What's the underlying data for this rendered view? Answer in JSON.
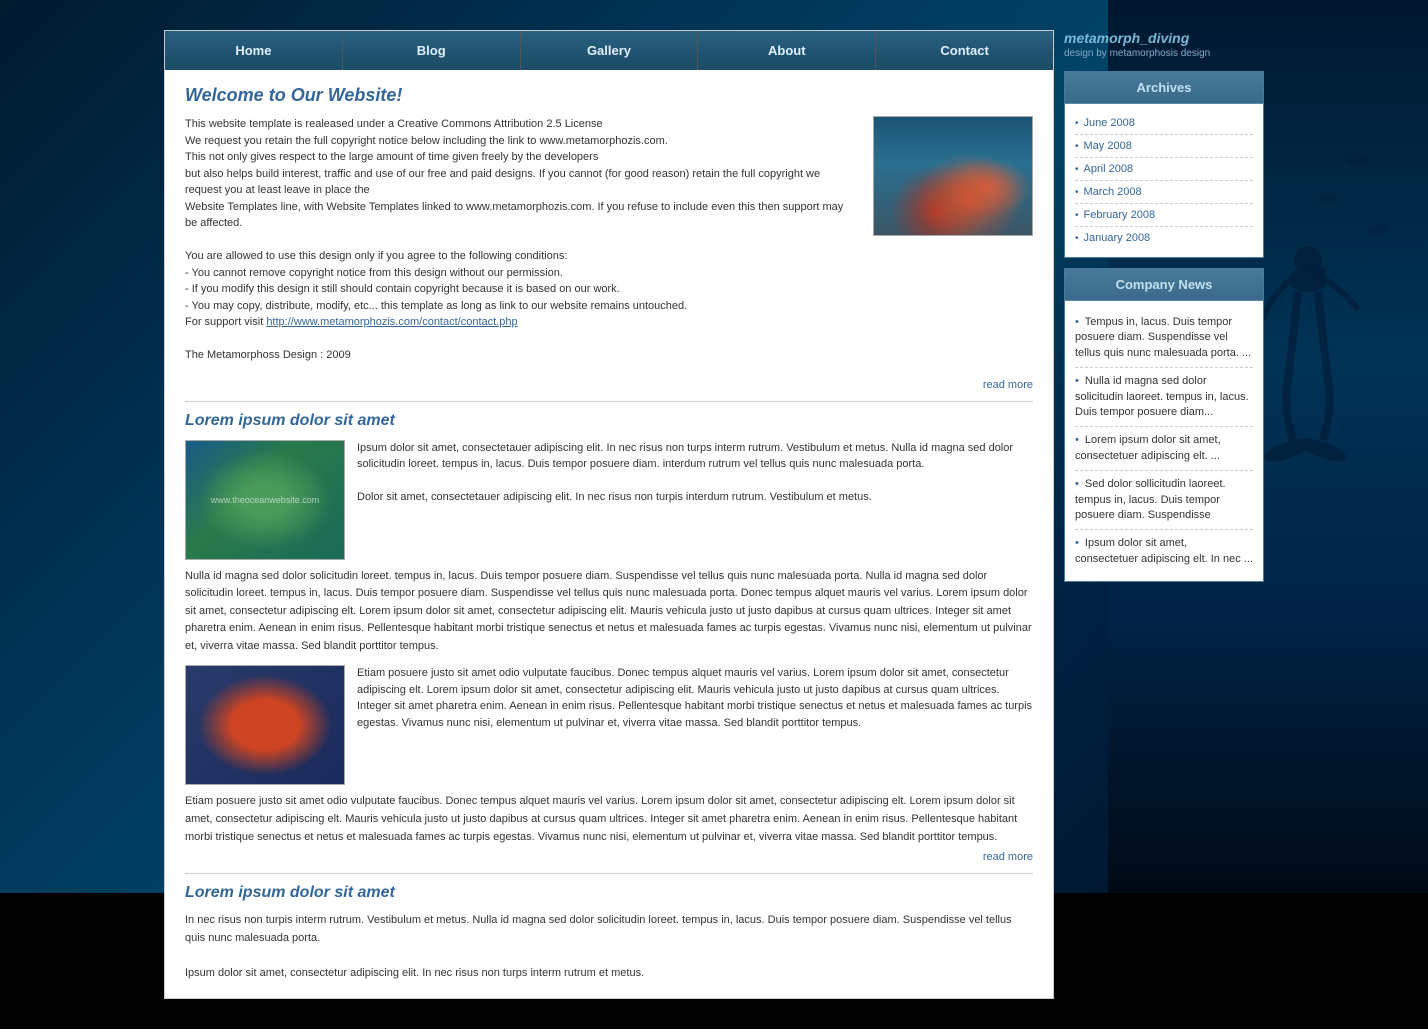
{
  "site": {
    "brand": "metamorph_diving",
    "tagline": "design by metamorphosis design"
  },
  "nav": {
    "items": [
      {
        "label": "Home",
        "id": "home"
      },
      {
        "label": "Blog",
        "id": "blog"
      },
      {
        "label": "Gallery",
        "id": "gallery"
      },
      {
        "label": "About",
        "id": "about"
      },
      {
        "label": "Contact",
        "id": "contact"
      }
    ]
  },
  "main": {
    "welcome_title": "Welcome to Our Website!",
    "welcome_text_1": "This website template is realeased under a Creative Commons Attribution 2.5 License",
    "welcome_text_2": "We request you retain the full copyright notice below including the link to www.metamorphozis.com.",
    "welcome_text_3": "This not only gives respect to the large amount of time given freely by the developers",
    "welcome_text_4": "but also helps build interest, traffic and use of our free and paid designs. If you cannot (for good reason) retain the full copyright we request you at least leave in place the",
    "welcome_text_5": "Website Templates line, with Website Templates linked to www.metamorphozis.com. If you refuse to include even this then support may be affected.",
    "welcome_text_6": "You are allowed to use this design only if you agree to the following conditions:",
    "welcome_text_7": "- You cannot remove copyright notice from this design without our permission.",
    "welcome_text_8": "- If you modify this design it still should contain copyright because it is based on our work.",
    "welcome_text_9": "- You may copy, distribute, modify, etc... this template as long as link to our website remains untouched.",
    "welcome_text_10": "For support visit ",
    "welcome_link": "http://www.metamorphozis.com/contact/contact.php",
    "welcome_copyright": "The Metamorphoss Design : 2009",
    "read_more": "read more",
    "article1_title": "Lorem ipsum dolor sit amet",
    "article1_text1": "Ipsum dolor sit amet, consectetauer adipiscing elit. In nec risus non turps interm rutrum. Vestibulum et metus. Nulla id magna sed dolor solicitudin loreet. tempus in, lacus. Duis tempor posuere diam. interdum rutrum vel tellus quis nunc malesuada porta.",
    "article1_text2": "Dolor sit amet, consectetauer adipiscing elit. In nec risus non turpis interdum rutrum. Vestibulum et metus.",
    "article1_text3": "Nulla id magna sed dolor solicitudin loreet. tempus in, lacus. Duis tempor posuere diam. Suspendisse vel tellus quis nunc malesuada porta. Nulla id magna sed dolor solicitudin loreet. tempus in, lacus. Duis tempor posuere diam. Suspendisse vel tellus quis nunc malesuada porta. Donec tempus alquet mauris vel varius. Lorem ipsum dolor sit amet, consectetur adipiscing elt. Lorem ipsum dolor sit amet, consectetur adipiscing elit. Mauris vehicula justo ut justo dapibus at cursus quam ultrices. Integer sit amet pharetra enim. Aenean in enim risus. Pellentesque habitant morbi tristique senectus et netus et malesuada fames ac turpis egestas. Vivamus nunc nisi, elementum ut pulvinar et, viverra vitae massa. Sed blandit porttitor tempus.",
    "article1_text4_intro": "Etiam posuere justo sit amet odio vulputate faucibus. Donec tempus alquet mauris vel varius. Lorem ipsum dolor sit amet, consectetur adipiscing elt. Lorem ipsum dolor sit amet, consectetur adipiscing elit. Mauris vehicula justo ut justo dapibus at cursus quam ultrices. Integer sit amet pharetra enim. Aenean in enim risus. Pellentesque habitant morbi tristique senectus et netus et malesuada fames ac turpis egestas. Vivamus nunc nisi, elementum ut pulvinar et, viverra vitae massa. Sed blandit porttitor tempus.",
    "article1_text4_body": "Etiam posuere justo sit amet odio vulputate faucibus. Donec tempus alquet mauris vel varius. Lorem ipsum dolor sit amet, consectetur adipiscing elt. Lorem ipsum dolor sit amet, consectetur adipiscing elt. Mauris vehicula justo ut justo dapibus at cursus quam ultrices. Integer sit amet pharetra enim. Aenean in enim risus. Pellentesque habitant morbi tristique senectus et netus et malesuada fames ac turpis egestas. Vivamus nunc nisi, elementum ut pulvinar et, viverra vitae massa. Sed blandit porttitor tempus.",
    "article2_title": "Lorem ipsum dolor sit amet",
    "article2_text1": "In nec risus non turpis interm rutrum. Vestibulum et metus. Nulla id magna sed dolor solicitudin loreet. tempus in, lacus. Duis tempor posuere diam. Suspendisse vel tellus quis nunc malesuada porta.",
    "article2_text2": "Ipsum dolor sit amet, consectetur adipiscing elit. In nec risus non turps interm rutrum et metus.",
    "watermark": "www.theoceanwebsite.com"
  },
  "sidebar": {
    "archives_title": "Archives",
    "archives": [
      {
        "label": "June 2008"
      },
      {
        "label": "May 2008"
      },
      {
        "label": "April 2008"
      },
      {
        "label": "March 2008"
      },
      {
        "label": "February 2008"
      },
      {
        "label": "January 2008"
      }
    ],
    "news_title": "Company News",
    "news_items": [
      {
        "text": "Tempus in, lacus. Duis tempor posuere diam. Suspendisse vel tellus quis nunc malesuada porta. ..."
      },
      {
        "text": "Nulla id magna sed dolor solicitudin laoreet. tempus in, lacus. Duis tempor posuere diam..."
      },
      {
        "text": "Lorem ipsum dolor sit amet, consectetuer adipiscing elt. ..."
      },
      {
        "text": "Sed dolor sollicitudin laoreet. tempus in, lacus. Duis tempor posuere diam. Suspendisse"
      },
      {
        "text": "Ipsum dolor sit amet, consectetuer adipiscing elt. In nec ..."
      }
    ]
  }
}
